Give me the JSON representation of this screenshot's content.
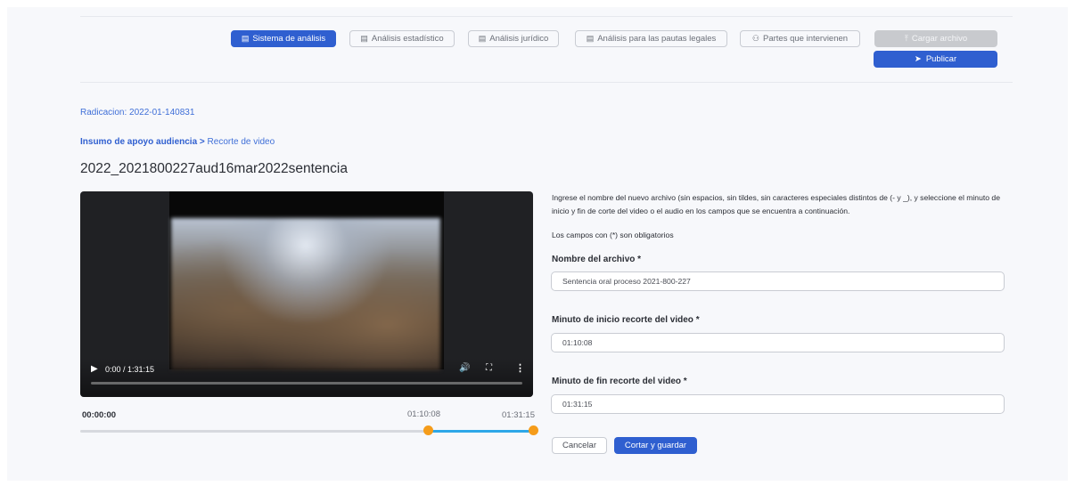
{
  "toolbar": {
    "buttons": [
      {
        "label": "Sistema de análisis",
        "icon": "book-icon"
      },
      {
        "label": "Análisis estadístico",
        "icon": "book-icon"
      },
      {
        "label": "Análisis jurídico",
        "icon": "book-icon"
      },
      {
        "label": "Análisis para las pautas legales",
        "icon": "book-icon"
      },
      {
        "label": "Partes que intervienen",
        "icon": "people-icon"
      },
      {
        "label": "Cargar archivo",
        "icon": "upload-icon"
      }
    ],
    "publish_label": "Publicar",
    "publish_icon": "send-icon"
  },
  "radicacion": "Radicacion: 2022-01-140831",
  "breadcrumb": {
    "parent": "Insumo de apoyo audiencia",
    "separator": ">",
    "current": "Recorte de video"
  },
  "page_title": "2022_2021800227aud16mar2022sentencia",
  "video": {
    "time_display": "0:00 / 1:31:15",
    "progress": 0
  },
  "range": {
    "start_label": "00:00:00",
    "cut_start_label": "01:10:08",
    "cut_end_label": "01:31:15",
    "start_fraction": 0.768,
    "end_fraction": 1.0
  },
  "form": {
    "instructions": "Ingrese el nombre del nuevo archivo (sin espacios, sin tildes, sin caracteres especiales distintos de (- y _), y seleccione el minuto de inicio y fin de corte del video o el audio en los campos que se encuentra a continuación.",
    "required_note": "Los campos con (*) son obligatorios",
    "name_label": "Nombre del archivo *",
    "name_value": "Sentencia oral proceso 2021-800-227",
    "start_label": "Minuto de inicio recorte del video *",
    "start_value": "01:10:08",
    "end_label": "Minuto de fin recorte del video *",
    "end_value": "01:31:15",
    "cancel_label": "Cancelar",
    "save_label": "Cortar y guardar"
  },
  "colors": {
    "primary": "#2f5fd0",
    "range_selection": "#2ea7e8",
    "handle": "#f59c1a"
  }
}
